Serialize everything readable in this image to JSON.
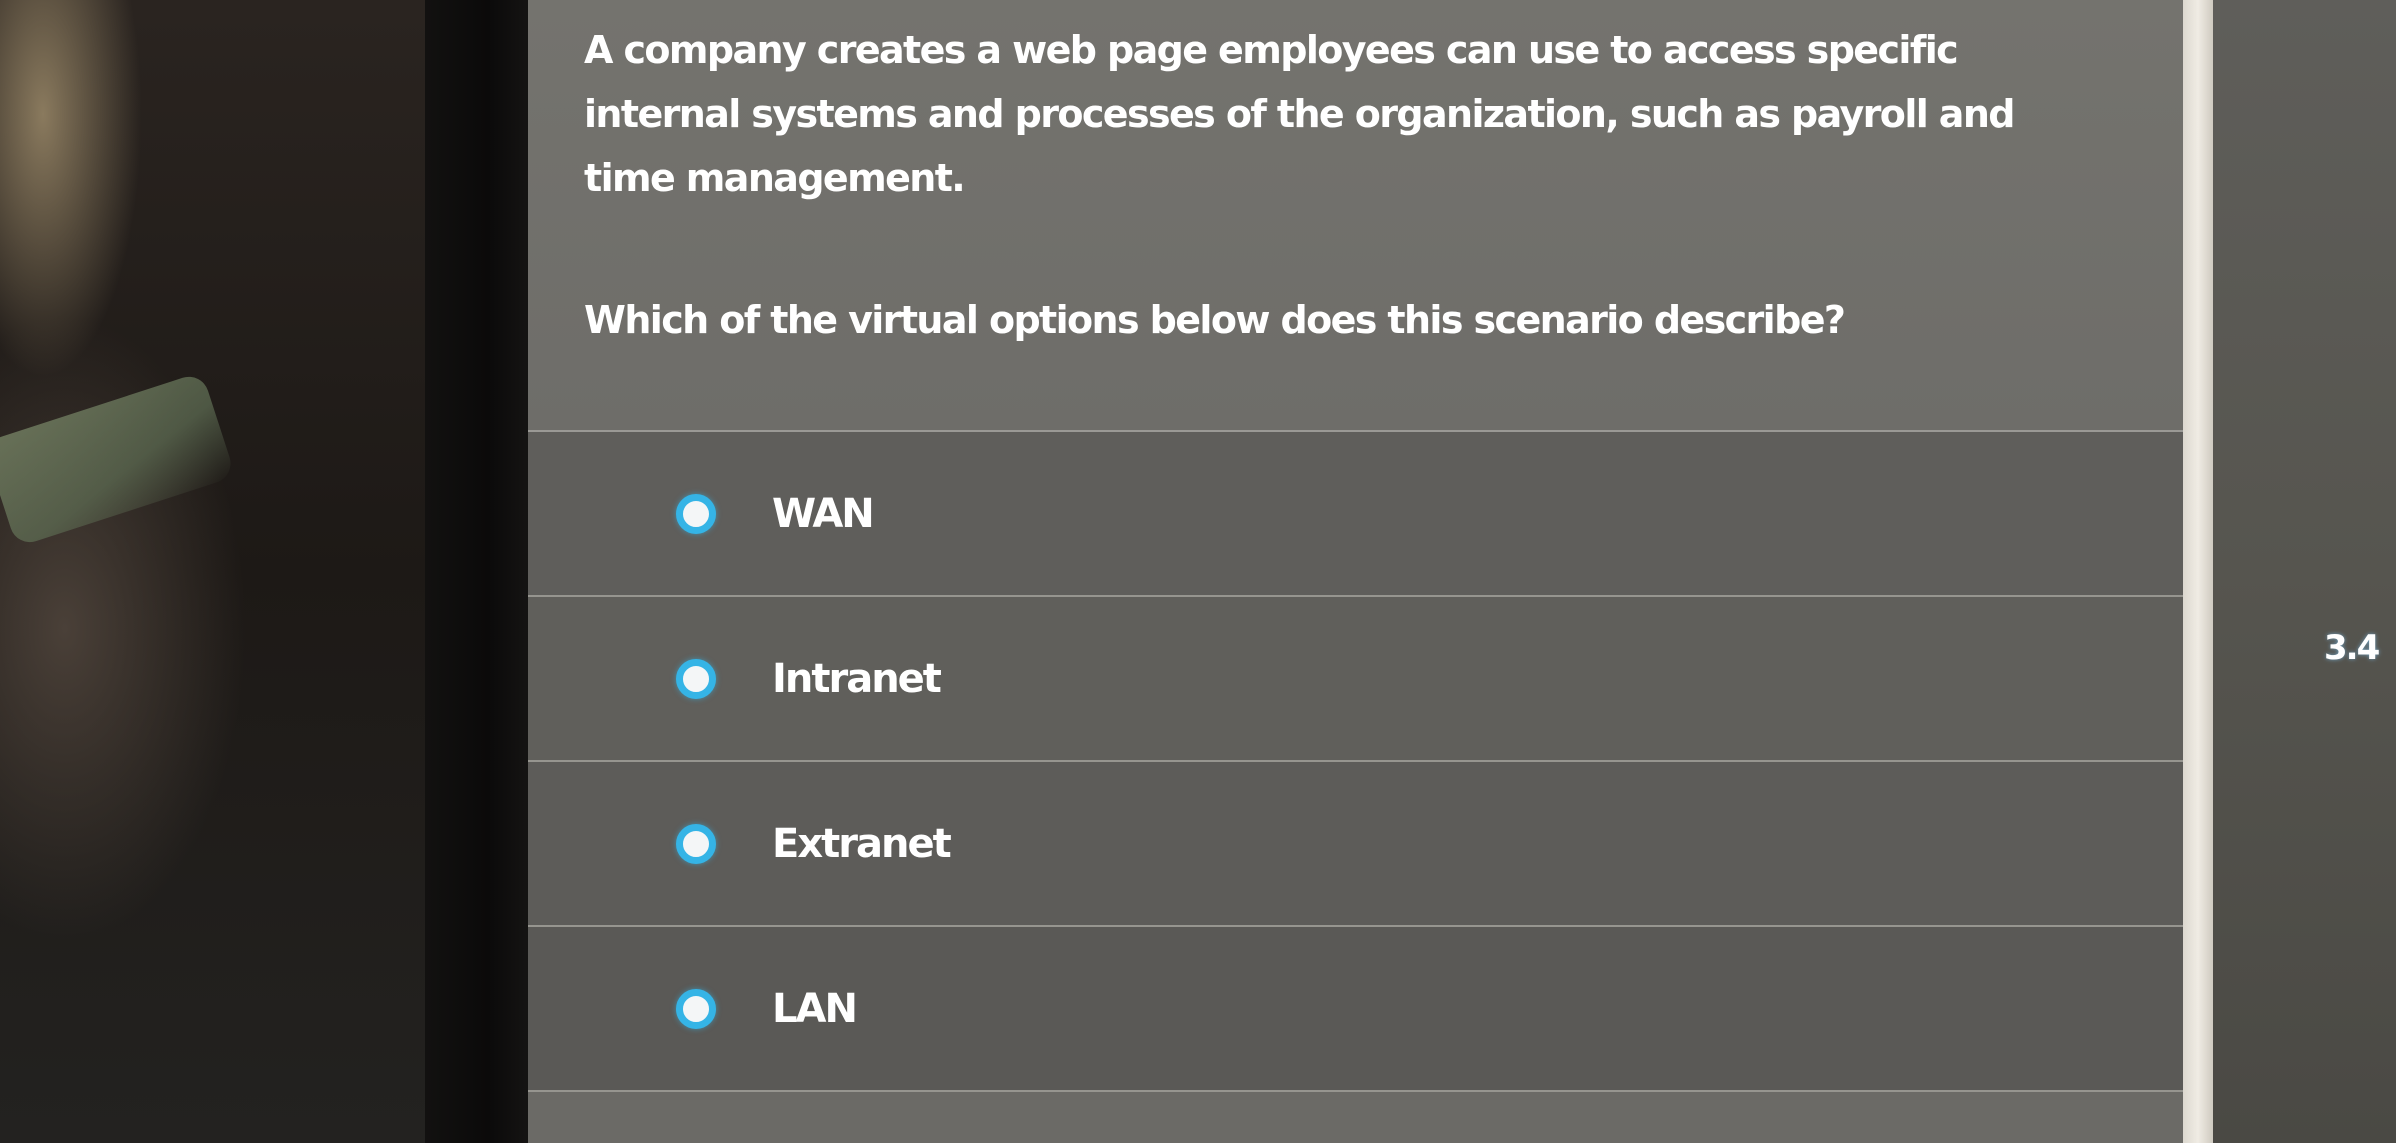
{
  "question": {
    "text": "A company creates a web page employees can use to access specific internal systems and processes of the organization, such as payroll and time management.",
    "prompt": "Which of the virtual options below does this scenario describe?"
  },
  "options": [
    {
      "label": "WAN",
      "selected": false
    },
    {
      "label": "Intranet",
      "selected": false
    },
    {
      "label": "Extranet",
      "selected": false
    },
    {
      "label": "LAN",
      "selected": false
    }
  ],
  "side_panel": {
    "number": "3.4"
  },
  "colors": {
    "radio_accent": "#35b4e6",
    "screen_bg": "#6b6a66",
    "option_bg": "#5f5e5b",
    "text": "#ffffff"
  }
}
